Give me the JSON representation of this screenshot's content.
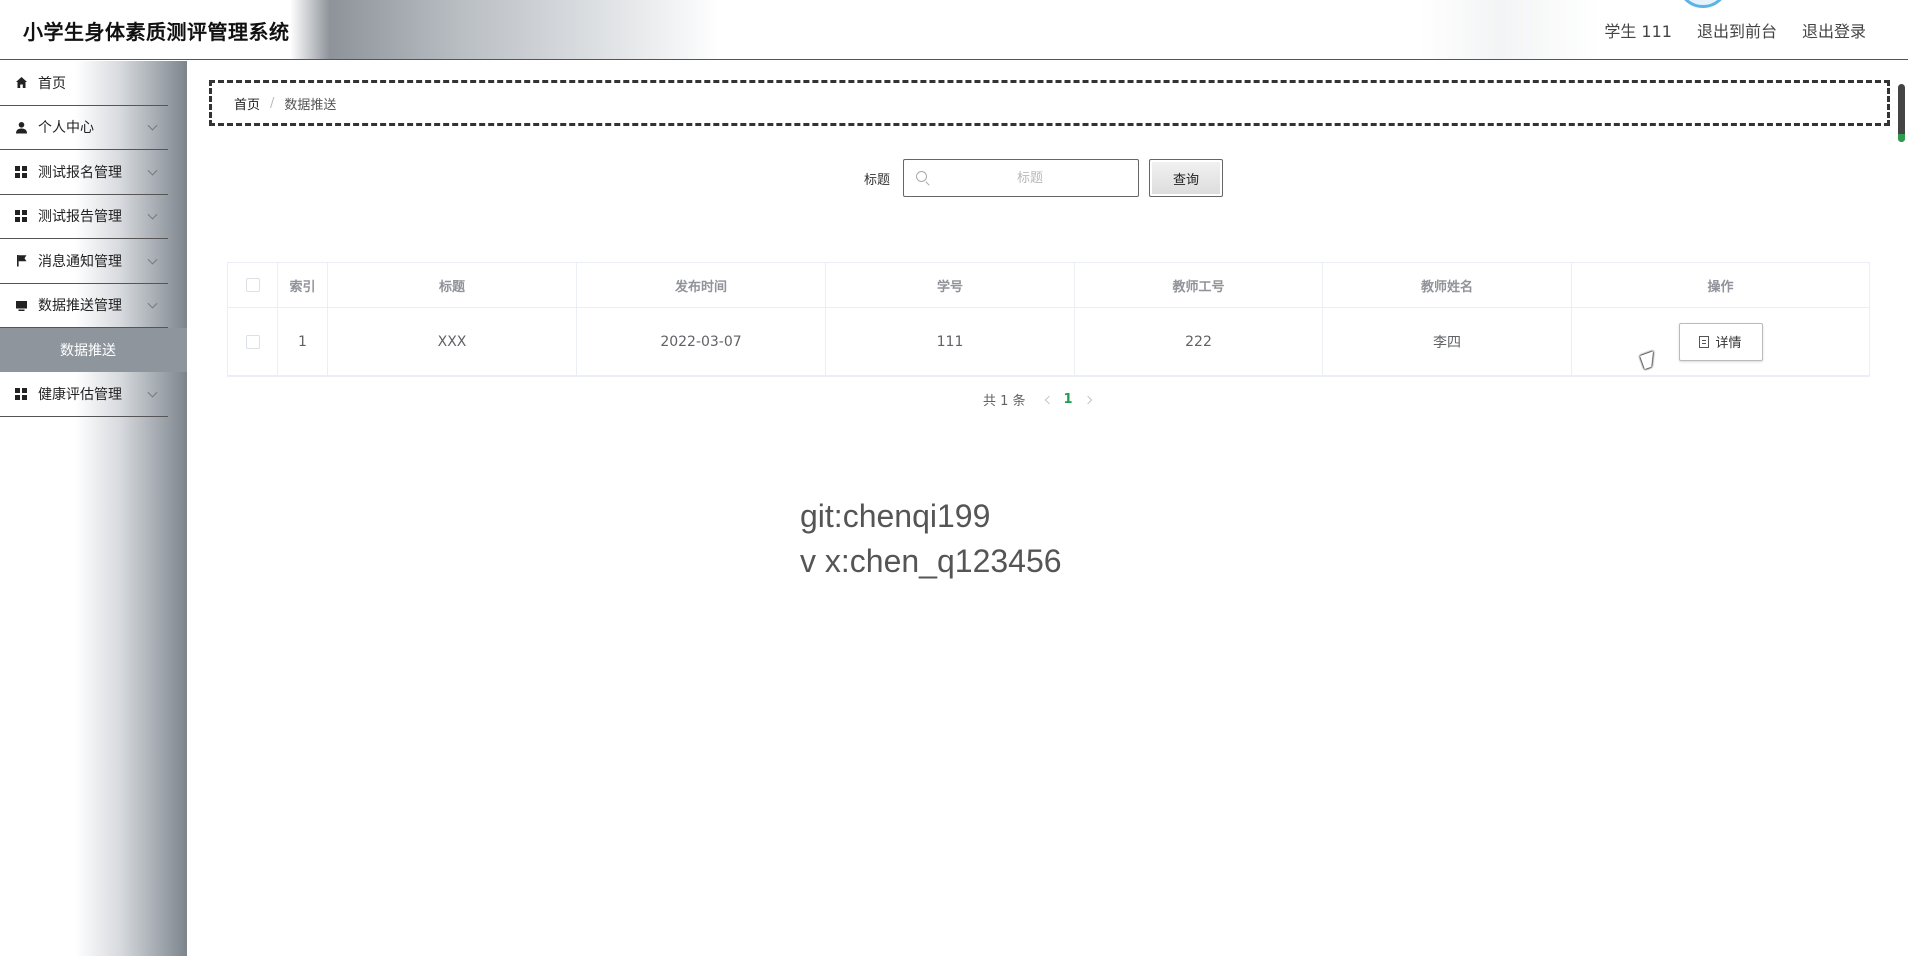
{
  "app": {
    "title": "小学生身体素质测评管理系统"
  },
  "header": {
    "user_label": "学生 111",
    "back_to_front": "退出到前台",
    "logout": "退出登录"
  },
  "sidebar": {
    "items": [
      {
        "label": "首页",
        "icon": "home-icon",
        "expandable": false
      },
      {
        "label": "个人中心",
        "icon": "user-icon",
        "expandable": true
      },
      {
        "label": "测试报名管理",
        "icon": "grid-icon",
        "expandable": true
      },
      {
        "label": "测试报告管理",
        "icon": "grid-icon",
        "expandable": true
      },
      {
        "label": "消息通知管理",
        "icon": "flag-icon",
        "expandable": true
      },
      {
        "label": "数据推送管理",
        "icon": "monitor-icon",
        "expandable": true
      },
      {
        "label": "健康评估管理",
        "icon": "grid-icon",
        "expandable": true
      }
    ],
    "active_submenu": "数据推送"
  },
  "breadcrumb": {
    "home": "首页",
    "separator": "/",
    "current": "数据推送"
  },
  "search": {
    "label": "标题",
    "placeholder": "标题",
    "value": "",
    "button": "查询"
  },
  "table": {
    "columns": [
      "索引",
      "标题",
      "发布时间",
      "学号",
      "教师工号",
      "教师姓名",
      "操作"
    ],
    "rows": [
      {
        "index": "1",
        "title": "XXX",
        "publish_time": "2022-03-07",
        "student_no": "111",
        "teacher_no": "222",
        "teacher_name": "李四",
        "action": "详情"
      }
    ]
  },
  "pagination": {
    "total_text": "共 1 条",
    "current_page": "1"
  },
  "watermark": {
    "line1": "git:chenqi199",
    "line2": "v x:chen_q123456"
  },
  "colors": {
    "accent_green": "#1f9d55",
    "submenu_active_bg": "#8e959c"
  }
}
